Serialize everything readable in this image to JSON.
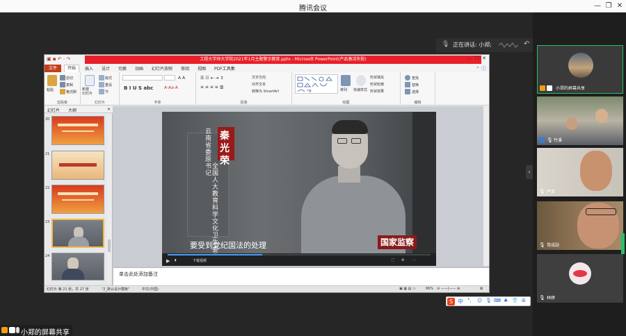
{
  "window": {
    "title": "腾讯会议",
    "minimize": "—",
    "restore": "❐",
    "close": "✕"
  },
  "speaking": {
    "label": "正在讲话: 小郑;"
  },
  "ppt": {
    "title": "工程大学师大学院2021年1月主题警示教育.pptx - Microsoft PowerPoint(产品激活失败)",
    "tabs": [
      "文件",
      "开始",
      "插入",
      "设计",
      "切换",
      "动画",
      "幻灯片放映",
      "审阅",
      "视图",
      "PDF工具集"
    ],
    "ribbon": {
      "clipboard": {
        "label": "剪贴板",
        "paste": "粘贴",
        "cut": "剪切",
        "copy": "复制",
        "format_painter": "格式刷"
      },
      "slides": {
        "label": "幻灯片",
        "new_slide": "新建\n幻灯片",
        "layout": "版式",
        "reset": "重设",
        "section": "节"
      },
      "font": {
        "label": "字体"
      },
      "paragraph": {
        "label": "段落",
        "text_direction": "文字方向",
        "align_text": "对齐文本",
        "smartart": "转换为 SmartArt"
      },
      "drawing": {
        "label": "绘图",
        "arrange": "排列",
        "quick_styles": "快速样式",
        "shape_fill": "形状填充",
        "shape_outline": "形状轮廓",
        "shape_effects": "形状效果"
      },
      "editing": {
        "label": "编辑",
        "find": "查找",
        "replace": "替换",
        "select": "选择"
      }
    },
    "thumb_tabs": [
      "幻灯片",
      "大纲"
    ],
    "slides": [
      {
        "num": "20"
      },
      {
        "num": "21"
      },
      {
        "num": "22"
      },
      {
        "num": "23"
      },
      {
        "num": "24"
      }
    ],
    "video": {
      "name": "秦光荣",
      "caption_col1": "云南省委原书记",
      "caption_col2": "全国人大教育科学文化卫生委员会原主任委员",
      "subtitle": "要受到党纪国法的处理",
      "watermark": "国家监察",
      "download": "下载视频"
    },
    "notes_placeholder": "单击此处添加备注",
    "status": {
      "slide_info": "幻灯片 第 21 张，共 27 张",
      "theme": "\"2_默认设计模板\"",
      "language": "中文(中国)",
      "zoom": "66%"
    }
  },
  "ime": {
    "mode": "中"
  },
  "share_badge": {
    "label": "小郑的屏幕共享"
  },
  "participants": [
    {
      "name": "小郑的屏幕共享"
    },
    {
      "name": "竹溪"
    },
    {
      "name": "严武"
    },
    {
      "name": "常成勋"
    },
    {
      "name": "林婷"
    }
  ]
}
